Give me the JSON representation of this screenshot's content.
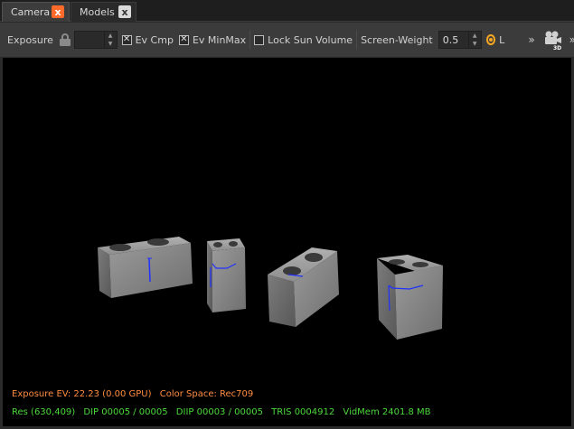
{
  "tabs": [
    {
      "label": "Camera",
      "active": true,
      "close": "x"
    },
    {
      "label": "Models",
      "active": false,
      "close": "x"
    }
  ],
  "toolbar": {
    "exposure_label": "Exposure",
    "exposure_value": "",
    "ev_cmp_label": "Ev Cmp",
    "ev_cmp_checked": true,
    "ev_minmax_label": "Ev MinMax",
    "ev_minmax_checked": true,
    "lock_sun_label": "Lock Sun Volume",
    "lock_sun_checked": false,
    "screen_weight_label": "Screen-Weight",
    "screen_weight_value": "0.5",
    "light_radio_label": "L",
    "more_left": "»",
    "more_right": "»",
    "camera_badge": "3D",
    "check_glyph": "✕"
  },
  "hud": {
    "exposure_ev": "Exposure EV: 22.23 (0.00 GPU)",
    "color_space": "Color Space: Rec709",
    "res": "Res (630,409)",
    "dip": "DIP 00005 / 00005",
    "diip": "DIIP 00003 / 00005",
    "tris": "TRIS 0004912",
    "vidmem": "VidMem 2401.8 MB"
  },
  "colors": {
    "accent_orange": "#ff6a2b",
    "radio_orange": "#f5a623",
    "hud_orange": "#ff8c40",
    "hud_green": "#4cd83c",
    "block_gray": "#8a8a8a",
    "gizmo_blue": "#2030ff"
  },
  "icons": {
    "lock": "lock-icon",
    "camera": "camera-3d-icon",
    "close": "close-icon"
  }
}
